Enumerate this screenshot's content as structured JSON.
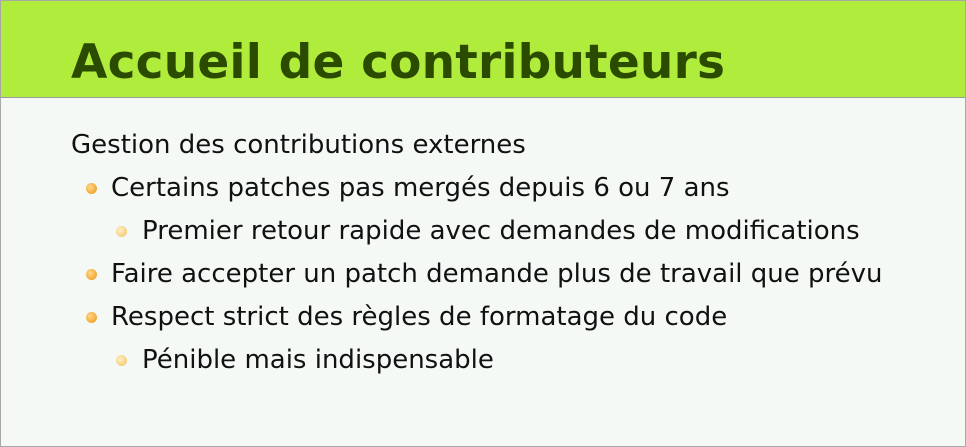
{
  "slide": {
    "title": "Accueil de contributeurs",
    "items": [
      {
        "text": "Gestion des contributions externes",
        "level": 0,
        "bullet": "none"
      },
      {
        "text": "Certains patches pas mergés depuis 6 ou 7 ans",
        "level": 1,
        "bullet": "orange-dot-icon"
      },
      {
        "text": "Premier retour rapide avec demandes de modifications",
        "level": 2,
        "bullet": "light-orange-dot-icon"
      },
      {
        "text": "Faire accepter un patch demande plus de travail que prévu",
        "level": 1,
        "bullet": "orange-dot-icon"
      },
      {
        "text": "Respect strict des règles de formatage du code",
        "level": 1,
        "bullet": "orange-dot-icon"
      },
      {
        "text": "Pénible mais indispensable",
        "level": 2,
        "bullet": "light-orange-dot-icon"
      }
    ]
  },
  "colors": {
    "title_bar": "#b0ec3c",
    "title_text": "#2b4b00",
    "background": "#f5f9f6",
    "bullet": "#f5ae3e"
  }
}
